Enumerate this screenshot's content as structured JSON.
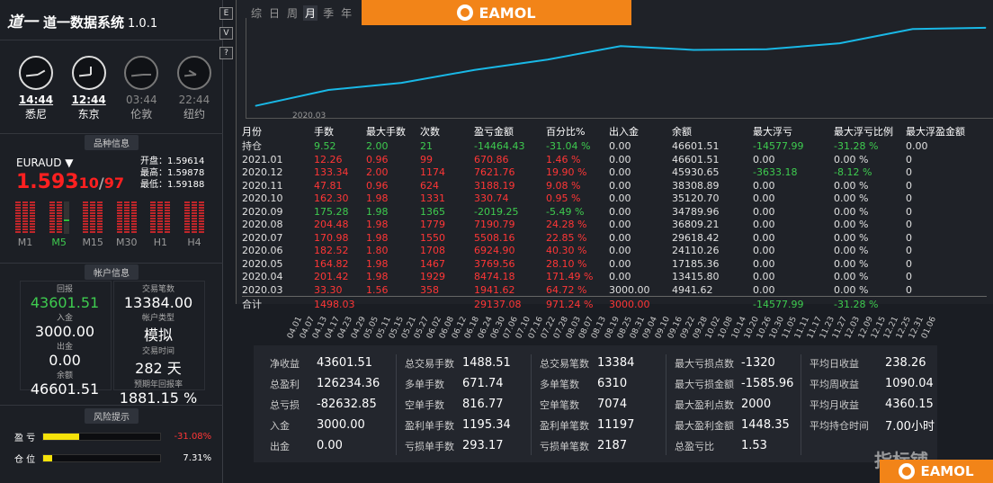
{
  "app": {
    "logo_mark": "道一",
    "title": "道一数据系统",
    "version": "1.0.1"
  },
  "clocks": [
    {
      "time": "14:44",
      "city": "悉尼",
      "active": true,
      "hour_deg": 60,
      "min_deg": 264
    },
    {
      "time": "12:44",
      "city": "东京",
      "active": true,
      "hour_deg": 0,
      "min_deg": 264
    },
    {
      "time": "03:44",
      "city": "伦敦",
      "active": false,
      "hour_deg": 90,
      "min_deg": 264
    },
    {
      "time": "22:44",
      "city": "纽约",
      "active": false,
      "hour_deg": 300,
      "min_deg": 264
    }
  ],
  "variety": {
    "section_title": "品种信息",
    "symbol": "EURAUD",
    "dropdown_icon": "caret-down-icon",
    "price_main": "1.593",
    "price_small": "10",
    "price_sep": "/",
    "price_small2": "97",
    "open_label": "开盘：",
    "open": "1.59614",
    "high_label": "最高：",
    "high": "1.59878",
    "low_label": "最低：",
    "low": "1.59188",
    "timeframes": [
      "M1",
      "M5",
      "M15",
      "M30",
      "H1",
      "H4"
    ],
    "active_tf": "M5"
  },
  "account": {
    "section_title": "帐户信息",
    "profit_label": "回报",
    "profit": "43601.51",
    "trades_label": "交易笔数",
    "trades": "13384.00",
    "deposit_label": "入金",
    "deposit": "3000.00",
    "account_type_label": "帐户类型",
    "account_type": "模拟",
    "withdraw_label": "出金",
    "withdraw": "0.00",
    "trade_time_label": "交易时间",
    "trade_time": "282 天",
    "balance_label": "余额",
    "balance": "46601.51",
    "annual_label": "预期年回报率",
    "annual": "1881.15 %"
  },
  "risk": {
    "section_title": "风险提示",
    "pl_label": "盈 亏",
    "pl_value": "-31.08%",
    "pl_fraction": 0.31,
    "pos_label": "仓 位",
    "pos_value": "7.31%",
    "pos_fraction": 0.073
  },
  "side_buttons": [
    "E",
    "V",
    "?"
  ],
  "tabs": [
    "综",
    "日",
    "周",
    "月",
    "季",
    "年"
  ],
  "active_tab": "月",
  "brand": {
    "name": "EAMOL",
    "watermark": "指标铺"
  },
  "chart_data": {
    "type": "line",
    "x_label_visible": "2020.03",
    "x": [
      "2020.03",
      "2020.04",
      "2020.05",
      "2020.06",
      "2020.07",
      "2020.08",
      "2020.09",
      "2020.10",
      "2020.11",
      "2020.12",
      "2021.01"
    ],
    "y": [
      4942,
      13416,
      17185,
      24110,
      29618,
      36809,
      34790,
      35120,
      38308,
      45931,
      46601
    ],
    "ylim": [
      0,
      47000
    ],
    "color": "#19b8e6"
  },
  "table": {
    "headers": [
      "月份",
      "手数",
      "最大手数",
      "次数",
      "盈亏金额",
      "百分比%",
      "出入金",
      "余额",
      "最大浮亏",
      "最大浮亏比例",
      "最大浮盈金额"
    ],
    "rows": [
      [
        "持仓",
        "9.52",
        "2.00",
        "21",
        "-14464.43",
        "-31.04 %",
        "0.00",
        "46601.51",
        "-14577.99",
        "-31.28 %",
        "0.00"
      ],
      [
        "2021.01",
        "12.26",
        "0.96",
        "99",
        "670.86",
        "1.46 %",
        "0.00",
        "46601.51",
        "0.00",
        "0.00 %",
        "0"
      ],
      [
        "2020.12",
        "133.34",
        "2.00",
        "1174",
        "7621.76",
        "19.90 %",
        "0.00",
        "45930.65",
        "-3633.18",
        "-8.12 %",
        "0"
      ],
      [
        "2020.11",
        "47.81",
        "0.96",
        "624",
        "3188.19",
        "9.08 %",
        "0.00",
        "38308.89",
        "0.00",
        "0.00 %",
        "0"
      ],
      [
        "2020.10",
        "162.30",
        "1.98",
        "1331",
        "330.74",
        "0.95 %",
        "0.00",
        "35120.70",
        "0.00",
        "0.00 %",
        "0"
      ],
      [
        "2020.09",
        "175.28",
        "1.98",
        "1365",
        "-2019.25",
        "-5.49 %",
        "0.00",
        "34789.96",
        "0.00",
        "0.00 %",
        "0"
      ],
      [
        "2020.08",
        "204.48",
        "1.98",
        "1779",
        "7190.79",
        "24.28 %",
        "0.00",
        "36809.21",
        "0.00",
        "0.00 %",
        "0"
      ],
      [
        "2020.07",
        "170.98",
        "1.98",
        "1550",
        "5508.16",
        "22.85 %",
        "0.00",
        "29618.42",
        "0.00",
        "0.00 %",
        "0"
      ],
      [
        "2020.06",
        "182.52",
        "1.80",
        "1708",
        "6924.90",
        "40.30 %",
        "0.00",
        "24110.26",
        "0.00",
        "0.00 %",
        "0"
      ],
      [
        "2020.05",
        "164.82",
        "1.98",
        "1467",
        "3769.56",
        "28.10 %",
        "0.00",
        "17185.36",
        "0.00",
        "0.00 %",
        "0"
      ],
      [
        "2020.04",
        "201.42",
        "1.98",
        "1929",
        "8474.18",
        "171.49 %",
        "0.00",
        "13415.80",
        "0.00",
        "0.00 %",
        "0"
      ],
      [
        "2020.03",
        "33.30",
        "1.56",
        "358",
        "1941.62",
        "64.72 %",
        "3000.00",
        "4941.62",
        "0.00",
        "0.00 %",
        "0"
      ],
      [
        "合计",
        "1498.03",
        "",
        "",
        "29137.08",
        "971.24 %",
        "3000.00",
        "",
        "-14577.99",
        "-31.28 %",
        ""
      ]
    ],
    "row_colors": [
      "g",
      "r",
      "r",
      "r",
      "r",
      "g",
      "r",
      "r",
      "r",
      "r",
      "r",
      "r",
      "r"
    ]
  },
  "dates": [
    "04.01",
    "04.07",
    "04.13",
    "04.17",
    "04.23",
    "04.29",
    "05.05",
    "05.11",
    "05.15",
    "05.21",
    "05.27",
    "06.02",
    "06.08",
    "06.12",
    "06.18",
    "06.24",
    "06.30",
    "07.06",
    "07.10",
    "07.16",
    "07.22",
    "07.28",
    "08.03",
    "08.07",
    "08.13",
    "08.19",
    "08.25",
    "08.31",
    "09.04",
    "09.10",
    "09.16",
    "09.22",
    "09.28",
    "10.02",
    "10.08",
    "10.14",
    "10.20",
    "10.26",
    "10.30",
    "11.05",
    "11.11",
    "11.17",
    "11.23",
    "11.27",
    "12.03",
    "12.09",
    "12.15",
    "12.21",
    "12.25",
    "12.31",
    "01.06"
  ],
  "stats": [
    [
      [
        "净收益",
        "43601.51"
      ],
      [
        "总盈利",
        "126234.36"
      ],
      [
        "总亏损",
        "-82632.85"
      ],
      [
        "入金",
        "3000.00"
      ],
      [
        "出金",
        "0.00"
      ]
    ],
    [
      [
        "总交易手数",
        "1488.51"
      ],
      [
        "多单手数",
        "671.74"
      ],
      [
        "空单手数",
        "816.77"
      ],
      [
        "盈利单手数",
        "1195.34"
      ],
      [
        "亏损单手数",
        "293.17"
      ]
    ],
    [
      [
        "总交易笔数",
        "13384"
      ],
      [
        "多单笔数",
        "6310"
      ],
      [
        "空单笔数",
        "7074"
      ],
      [
        "盈利单笔数",
        "11197"
      ],
      [
        "亏损单笔数",
        "2187"
      ]
    ],
    [
      [
        "最大亏损点数",
        "-1320"
      ],
      [
        "最大亏损金额",
        "-1585.96"
      ],
      [
        "最大盈利点数",
        "2000"
      ],
      [
        "最大盈利金额",
        "1448.35"
      ],
      [
        "总盈亏比",
        "1.53"
      ]
    ],
    [
      [
        "平均日收益",
        "238.26"
      ],
      [
        "平均周收益",
        "1090.04"
      ],
      [
        "平均月收益",
        "4360.15"
      ],
      [
        "平均持仓时间",
        "7.00小时"
      ]
    ]
  ]
}
